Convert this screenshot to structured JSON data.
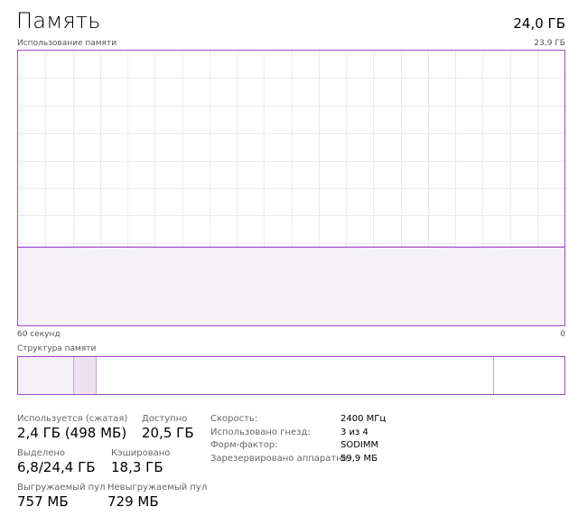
{
  "header": {
    "title": "Память",
    "total": "24,0 ГБ"
  },
  "chart": {
    "label": "Использование памяти",
    "max_label": "23,9 ГБ",
    "time_left": "60 секунд",
    "time_right": "0",
    "accent_color": "#a349c3",
    "grid_color": "#f0e6f3",
    "fill_color": "#f4f2f6"
  },
  "chart_data": {
    "type": "area",
    "title": "Использование памяти",
    "x_label_left": "60 секунд",
    "x_label_right": "0",
    "ylim": [
      0,
      23.9
    ],
    "grid": true,
    "x": [
      60,
      55,
      50,
      45,
      40,
      35,
      30,
      25,
      20,
      15,
      10,
      5,
      0
    ],
    "values": [
      6.8,
      6.8,
      6.81,
      6.8,
      6.8,
      6.8,
      6.8,
      6.8,
      6.81,
      6.81,
      6.8,
      6.81,
      6.81
    ]
  },
  "structure": {
    "label": "Структура памяти"
  },
  "stats": {
    "in_use_label": "Используется (сжатая)",
    "in_use_value": "2,4 ГБ (498 МБ)",
    "available_label": "Доступно",
    "available_value": "20,5 ГБ",
    "committed_label": "Выделено",
    "committed_value": "6,8/24,4 ГБ",
    "cached_label": "Кэшировано",
    "cached_value": "18,3 ГБ",
    "paged_label": "Выгружаемый пул",
    "paged_value": "757 МБ",
    "nonpaged_label": "Невыгружаемый пул",
    "nonpaged_value": "729 МБ"
  },
  "details": {
    "speed_label": "Скорость:",
    "speed_value": "2400 МГц",
    "slots_label": "Использовано гнезд:",
    "slots_value": "3 из 4",
    "form_label": "Форм-фактор:",
    "form_value": "SODIMM",
    "reserved_label": "Зарезервировано аппаратно:",
    "reserved_value": "59,9 МБ"
  }
}
